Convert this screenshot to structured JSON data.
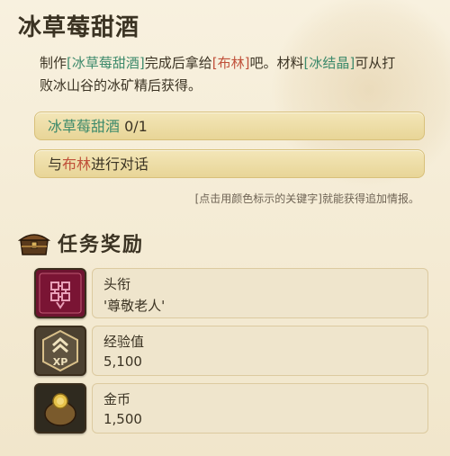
{
  "quest": {
    "title": "冰草莓甜酒",
    "description_parts": [
      {
        "text": "制作",
        "style": "normal"
      },
      {
        "text": "[冰草莓甜酒]",
        "style": "item"
      },
      {
        "text": "完成后拿给",
        "style": "normal"
      },
      {
        "text": "[布林]",
        "style": "npc"
      },
      {
        "text": "吧。材料",
        "style": "normal"
      },
      {
        "text": "[冰结晶]",
        "style": "item"
      },
      {
        "text": "可从打败冰山谷的冰矿精后获得。",
        "style": "normal"
      }
    ],
    "objectives": [
      {
        "pre": "冰草莓甜酒",
        "mid": "",
        "post": " 0/1"
      },
      {
        "pre": "与",
        "mid": "布林",
        "post": "进行对话"
      }
    ],
    "hint": "[点击用颜色标示的关键字]就能获得追加情报。"
  },
  "rewards": {
    "header": "任务奖励",
    "items": [
      {
        "label": "头衔",
        "value": "'尊敬老人'",
        "icon": "title-badge-icon"
      },
      {
        "label": "经验值",
        "value": "5,100",
        "icon": "xp-icon"
      },
      {
        "label": "金币",
        "value": "1,500",
        "icon": "coin-pouch-icon"
      }
    ]
  },
  "colors": {
    "item_keyword": "#3d8a6b",
    "npc_keyword": "#c0513a",
    "text": "#3b3323"
  }
}
